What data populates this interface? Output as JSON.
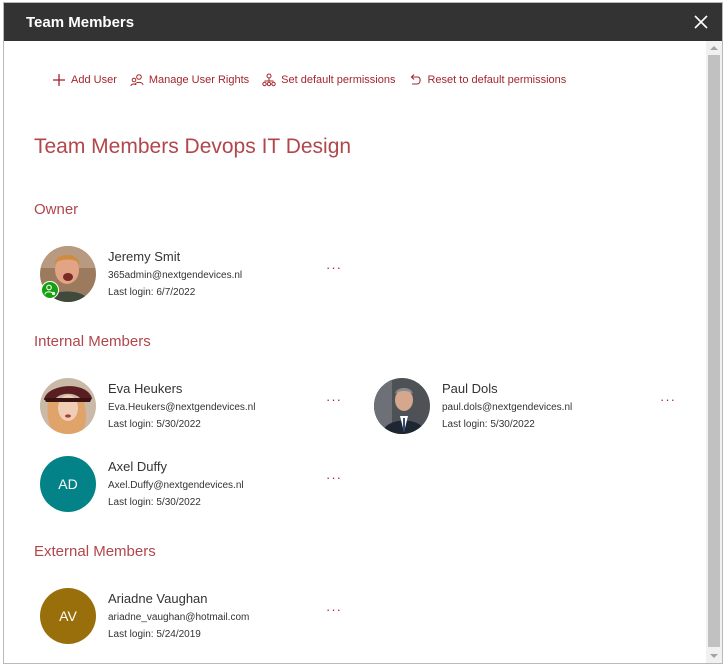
{
  "dialog": {
    "title": "Team Members"
  },
  "toolbar": {
    "add_user": "Add User",
    "manage_rights": "Manage User Rights",
    "set_default": "Set default permissions",
    "reset_default": "Reset to default permissions"
  },
  "page": {
    "title": "Team Members Devops IT Design"
  },
  "sections": {
    "owner": "Owner",
    "internal": "Internal Members",
    "external": "External Members"
  },
  "members": {
    "owner": [
      {
        "name": "Jeremy Smit",
        "email": "365admin@nextgendevices.nl",
        "last_login": "Last login: 6/7/2022"
      }
    ],
    "internal": [
      {
        "name": "Eva Heukers",
        "email": "Eva.Heukers@nextgendevices.nl",
        "last_login": "Last login: 5/30/2022"
      },
      {
        "name": "Paul Dols",
        "email": "paul.dols@nextgendevices.nl",
        "last_login": "Last login: 5/30/2022"
      },
      {
        "name": "Axel Duffy",
        "email": "Axel.Duffy@nextgendevices.nl",
        "last_login": "Last login: 5/30/2022",
        "initials": "AD",
        "color": "#038387"
      }
    ],
    "external": [
      {
        "name": "Ariadne Vaughan",
        "email": "ariadne_vaughan@hotmail.com",
        "last_login": "Last login: 5/24/2019",
        "initials": "AV",
        "color": "#986f0b"
      }
    ]
  },
  "more_label": "···",
  "colors": {
    "accent": "#a4262c",
    "titlebar": "#333333",
    "owner_badge": "#13a10e"
  }
}
